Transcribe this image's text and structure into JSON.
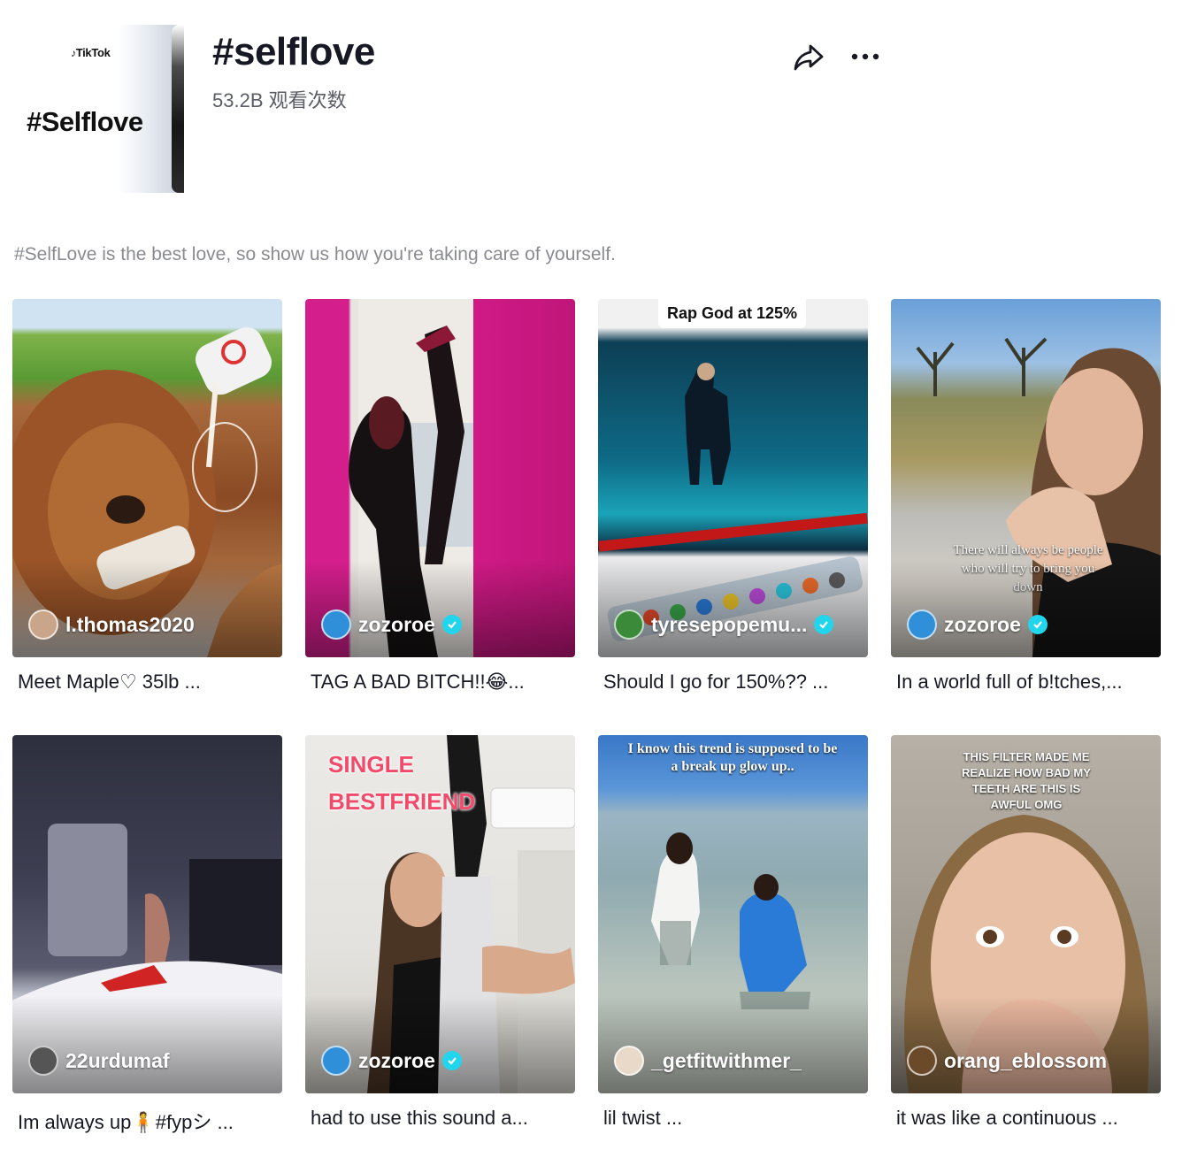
{
  "header": {
    "hero_brand": "TikTok",
    "hero_tag": "#Selflove",
    "title": "#selflove",
    "views": "53.2B 观看次数",
    "share_icon": "share-icon",
    "more_icon": "more-icon"
  },
  "description": "#SelfLove is the best love, so show us how you're taking care of yourself.",
  "videos": [
    {
      "username": "l.thomas2020",
      "verified": false,
      "caption": "Meet Maple♡ 35lb ...",
      "avatar_color": "#c9a68a"
    },
    {
      "username": "zozoroe",
      "verified": true,
      "caption": "TAG A BAD BITCH!!😂...",
      "avatar_color": "#2f8fd8"
    },
    {
      "username": "tyresepopemu...",
      "verified": true,
      "caption": "Should I go for 150%?? ...",
      "overlay": "Rap God at 125%",
      "avatar_color": "#3a8a3a"
    },
    {
      "username": "zozoroe",
      "verified": true,
      "caption": "In a world full of b!tches,...",
      "overlay": "There will always be people who will try to bring you down",
      "avatar_color": "#2f8fd8"
    },
    {
      "username": "22urdumaf",
      "verified": false,
      "caption": "Im always up🧍#fypシ ...",
      "avatar_color": "#555"
    },
    {
      "username": "zozoroe",
      "verified": true,
      "caption": "had to use this sound a...",
      "overlay": "SINGLE BESTFRIEND",
      "avatar_color": "#2f8fd8"
    },
    {
      "username": "_getfitwithmer_",
      "verified": false,
      "caption": "lil twist ...",
      "overlay": "I know this trend is supposed to be a break up glow up..",
      "avatar_color": "#e9d9c9"
    },
    {
      "username": "orang_eblossom",
      "verified": false,
      "caption": "it was like a continuous ...",
      "overlay": "THIS FILTER MADE ME REALIZE HOW BAD MY TEETH ARE THIS IS AWFUL OMG",
      "avatar_color": "#6b4a2a"
    }
  ],
  "colors": {
    "accent": "#20d5ec",
    "text": "#161823",
    "muted": "#8a8b91"
  }
}
